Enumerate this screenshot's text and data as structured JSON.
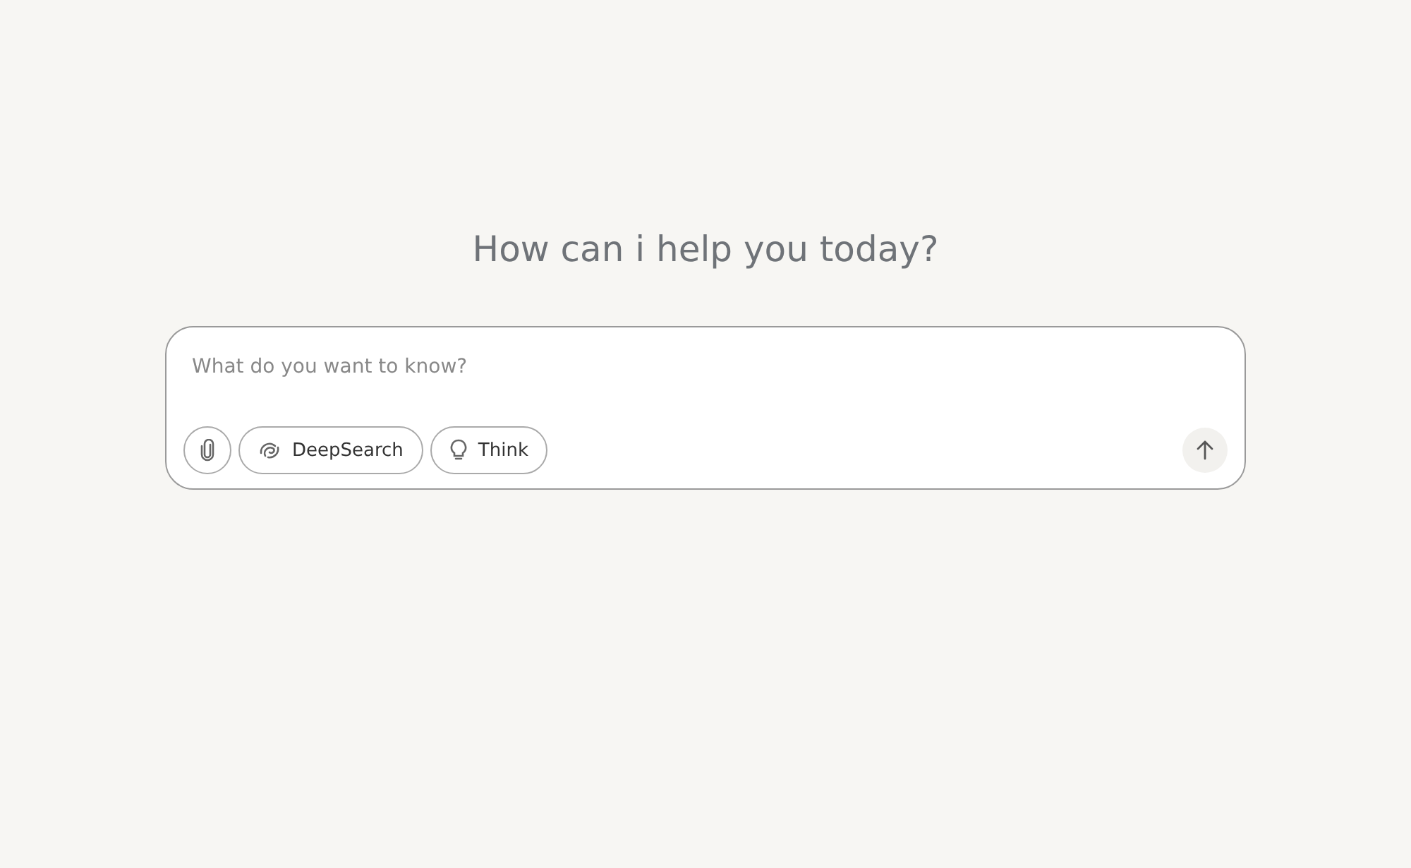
{
  "heading": "How can i help you today?",
  "prompt": {
    "placeholder": "What do you want to know?"
  },
  "tools": [
    {
      "kind": "attach"
    },
    {
      "kind": "deepsearch",
      "label": "DeepSearch"
    },
    {
      "kind": "think",
      "label": "Think"
    }
  ],
  "send": {
    "kind": "send"
  }
}
